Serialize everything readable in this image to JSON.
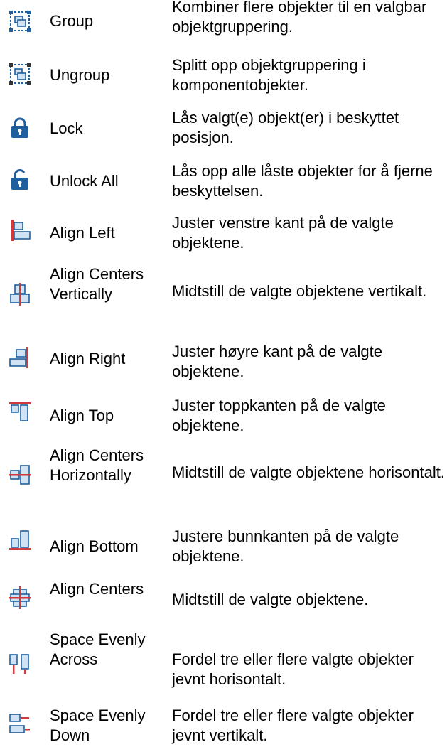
{
  "commands": [
    {
      "icon": "group-icon",
      "name": "Group",
      "description": "Kombiner flere objekter til en valgbar objektgruppering."
    },
    {
      "icon": "ungroup-icon",
      "name": "Ungroup",
      "description": "Splitt opp objektgruppering i komponentobjekter."
    },
    {
      "icon": "lock-icon",
      "name": "Lock",
      "description": "Lås valgt(e) objekt(er) i beskyttet posisjon."
    },
    {
      "icon": "unlock-all-icon",
      "name": "Unlock All",
      "description": "Lås opp alle låste objekter for å fjerne beskyttelsen."
    },
    {
      "icon": "align-left-icon",
      "name": "Align Left",
      "description": "Juster venstre kant på de valgte objektene."
    },
    {
      "icon": "align-centers-vertically-icon",
      "name": "Align Centers Vertically",
      "description": "Midtstill de valgte objektene vertikalt."
    },
    {
      "icon": "align-right-icon",
      "name": "Align Right",
      "description": "Juster høyre kant på de valgte objektene."
    },
    {
      "icon": "align-top-icon",
      "name": "Align Top",
      "description": "Juster toppkanten på de valgte objektene."
    },
    {
      "icon": "align-centers-horizontally-icon",
      "name": "Align Centers Horizontally",
      "description": "Midtstill de valgte objektene horisontalt."
    },
    {
      "icon": "align-bottom-icon",
      "name": "Align Bottom",
      "description": "Justere bunnkanten på de valgte objektene."
    },
    {
      "icon": "align-centers-icon",
      "name": "Align Centers",
      "description": "Midtstill de valgte objektene."
    },
    {
      "icon": "space-evenly-across-icon",
      "name": "Space Evenly Across",
      "description": "Fordel tre eller flere valgte objekter jevnt horisontalt."
    },
    {
      "icon": "space-evenly-down-icon",
      "name": "Space Evenly Down",
      "description": "Fordel tre eller flere valgte objekter jevnt vertikalt."
    }
  ],
  "colors": {
    "icon_blue": "#1f5f9e",
    "icon_fill": "#cfe3f5",
    "icon_red": "#d03a3a",
    "icon_dark": "#333333"
  }
}
